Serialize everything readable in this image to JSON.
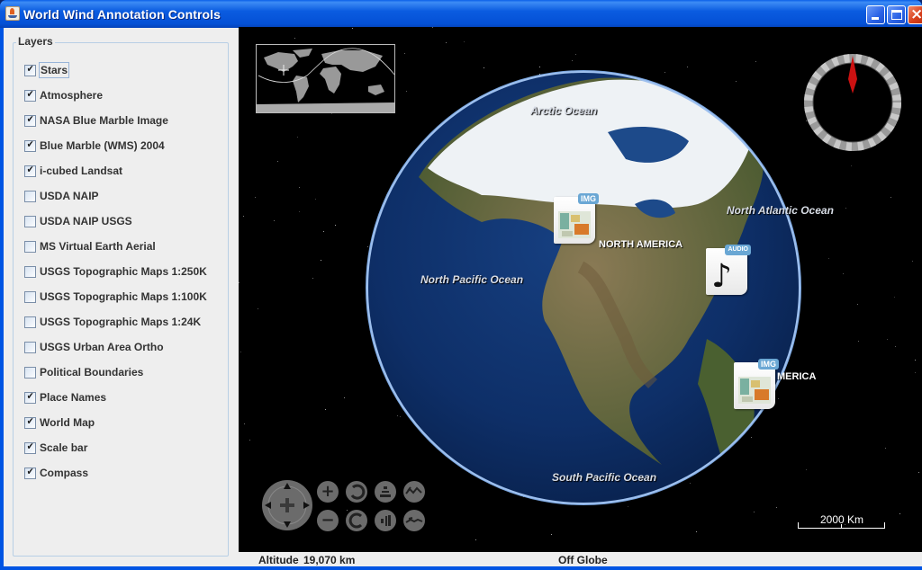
{
  "window": {
    "title": "World Wind Annotation Controls",
    "controls": {
      "minimize": "minimize",
      "maximize": "maximize",
      "close": "close"
    }
  },
  "layers_panel": {
    "title": "Layers",
    "items": [
      {
        "label": "Stars",
        "checked": true,
        "focused": true
      },
      {
        "label": "Atmosphere",
        "checked": true
      },
      {
        "label": "NASA Blue Marble Image",
        "checked": true
      },
      {
        "label": "Blue Marble (WMS) 2004",
        "checked": true
      },
      {
        "label": "i-cubed Landsat",
        "checked": true
      },
      {
        "label": "USDA NAIP",
        "checked": false
      },
      {
        "label": "USDA NAIP USGS",
        "checked": false
      },
      {
        "label": "MS Virtual Earth Aerial",
        "checked": false
      },
      {
        "label": "USGS Topographic Maps 1:250K",
        "checked": false
      },
      {
        "label": "USGS Topographic Maps 1:100K",
        "checked": false
      },
      {
        "label": "USGS Topographic Maps 1:24K",
        "checked": false
      },
      {
        "label": "USGS Urban Area Ortho",
        "checked": false
      },
      {
        "label": "Political Boundaries",
        "checked": false
      },
      {
        "label": "Place Names",
        "checked": true
      },
      {
        "label": "World Map",
        "checked": true
      },
      {
        "label": "Scale bar",
        "checked": true
      },
      {
        "label": "Compass",
        "checked": true
      }
    ]
  },
  "globe": {
    "ocean_labels": [
      "Arctic Ocean",
      "North Atlantic Ocean",
      "North Pacific Ocean",
      "South Pacific Ocean"
    ],
    "continent_labels": [
      "NORTH AMERICA",
      "MERICA"
    ],
    "annotations": [
      {
        "type": "image",
        "badge": "IMG"
      },
      {
        "type": "audio",
        "badge": "AUDIO"
      },
      {
        "type": "image",
        "badge": "IMG"
      }
    ],
    "scalebar_label": "2000 Km",
    "colors": {
      "ocean": "#123c7a",
      "land": "#5a6a3a",
      "ice": "#eef2f5",
      "atmosphere": "#7aa6e0",
      "compass_needle": "#cc1111"
    }
  },
  "nav_controls": {
    "pan": "pan",
    "buttons": [
      "zoom-in",
      "zoom-out",
      "rotate-left",
      "rotate-right",
      "tilt-up",
      "tilt-down",
      "exaggeration-up",
      "exaggeration-down"
    ],
    "glyphs": {
      "zoom_in": "+",
      "zoom_out": "−"
    }
  },
  "status_bar": {
    "altitude_label": "Altitude",
    "altitude_value": "19,070 km",
    "position": "Off Globe"
  }
}
